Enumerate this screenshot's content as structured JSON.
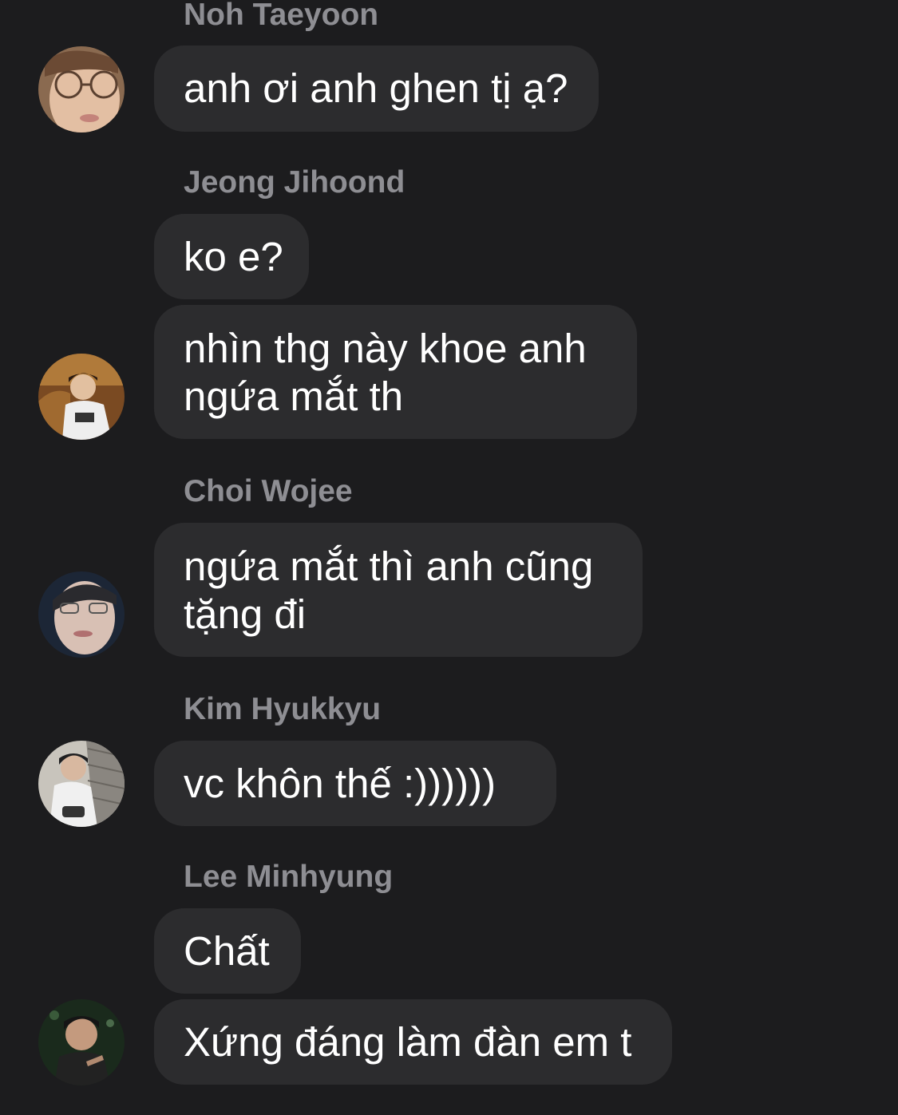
{
  "messages": [
    {
      "sender": "Noh Taeyoon",
      "lines": [
        "anh ơi anh ghen tị ạ?"
      ]
    },
    {
      "sender": "Jeong Jihoond",
      "lines": [
        "ko e?"
      ]
    },
    {
      "lines": [
        "nhìn thg này khoe anh",
        "ngứa mắt th"
      ]
    },
    {
      "sender": "Choi Wojee",
      "lines": [
        "ngứa mắt thì anh cũng",
        "tặng đi"
      ]
    },
    {
      "sender": "Kim Hyukkyu",
      "lines": [
        "vc khôn thế :))))))"
      ]
    },
    {
      "sender": "Lee Minhyung",
      "lines": [
        "Chất"
      ]
    },
    {
      "lines": [
        "Xứng đáng làm đàn em t"
      ]
    }
  ],
  "avatars": [
    {
      "name": "avatar-noh-taeyoon",
      "icon": "profile-photo"
    },
    {
      "name": "avatar-jeong-jihoond",
      "icon": "profile-photo"
    },
    {
      "name": "avatar-choi-wojee",
      "icon": "profile-photo"
    },
    {
      "name": "avatar-kim-hyukkyu",
      "icon": "profile-photo"
    },
    {
      "name": "avatar-lee-minhyung",
      "icon": "profile-photo"
    }
  ],
  "colors": {
    "background": "#1c1c1e",
    "bubble": "#2c2c2e",
    "sender_name": "#8e8e93",
    "message_text": "#ffffff"
  }
}
